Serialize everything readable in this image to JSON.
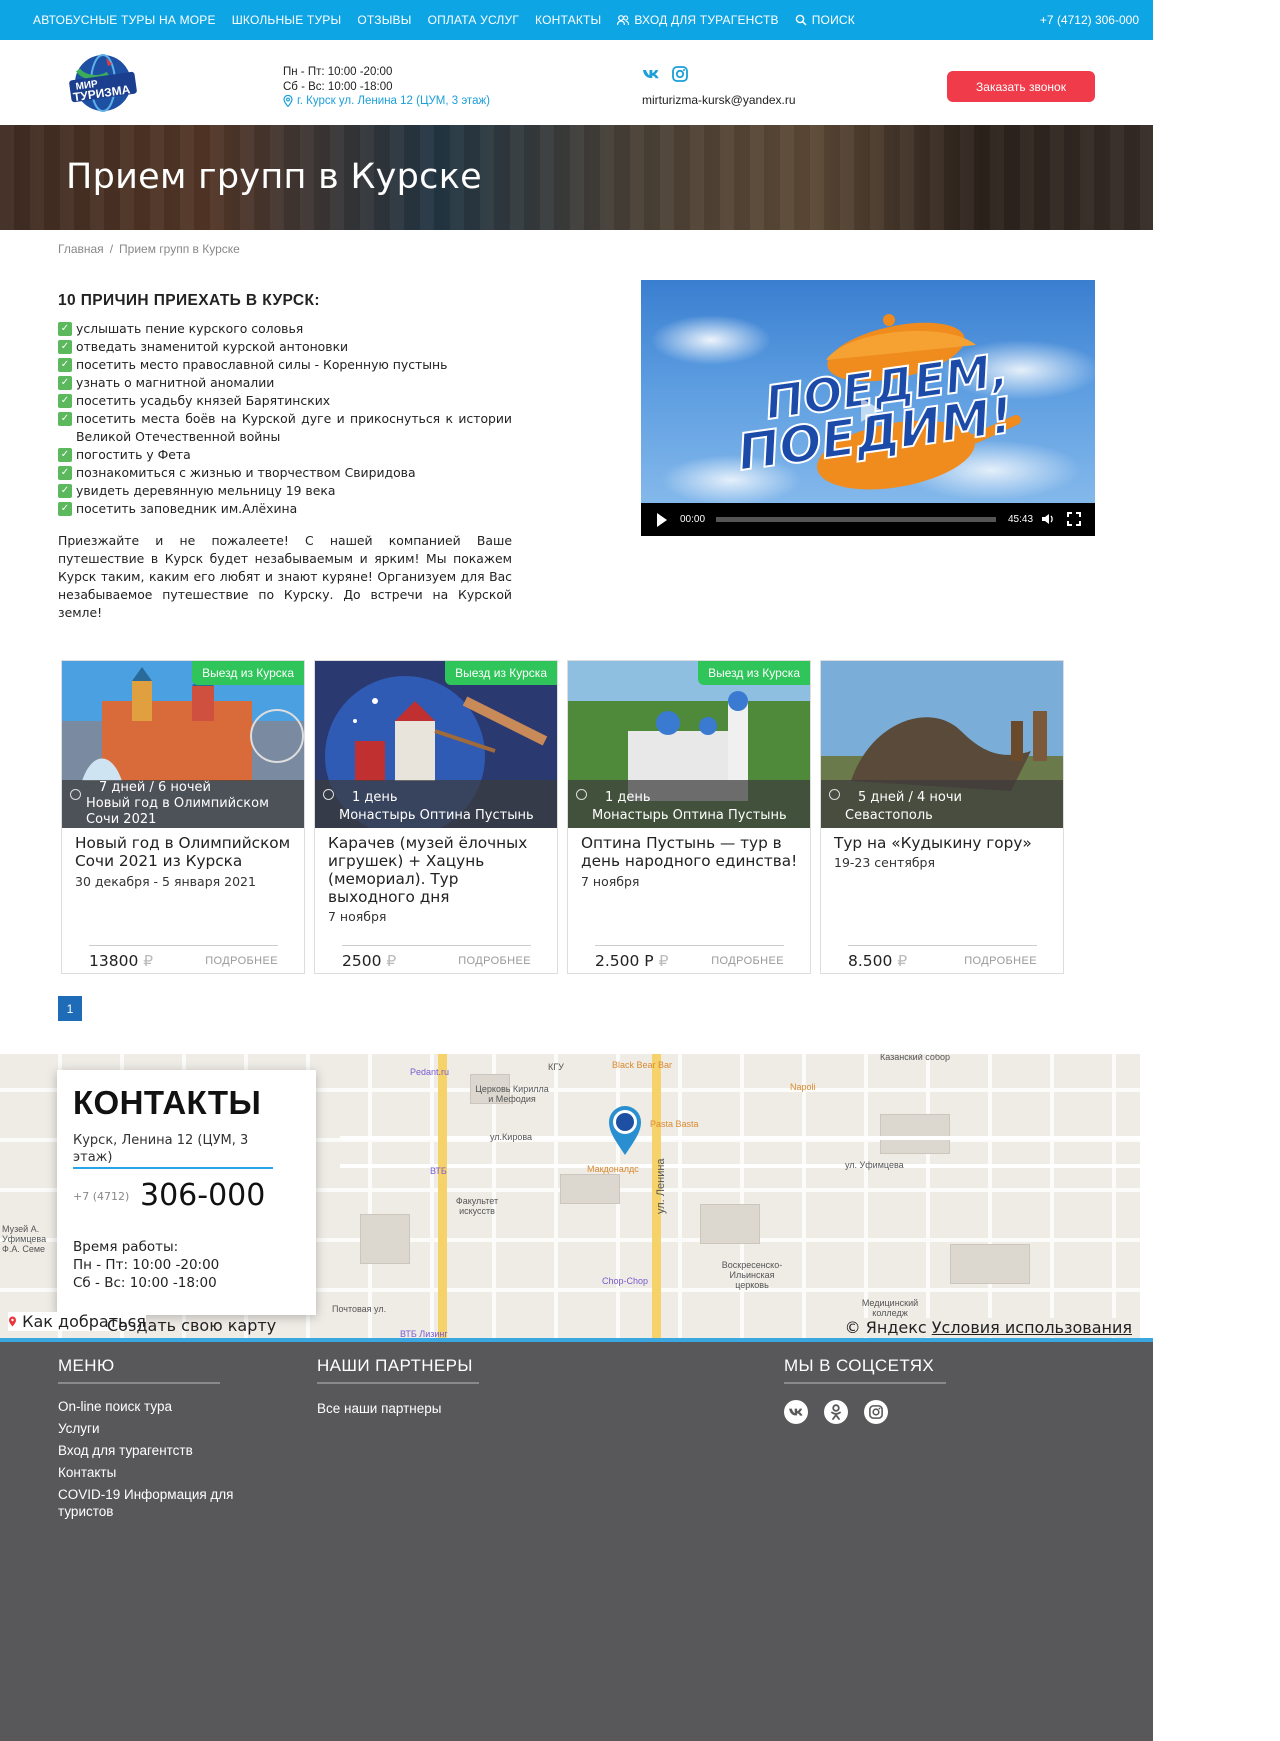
{
  "topbar": {
    "nav": [
      "АВТОБУСНЫЕ ТУРЫ НА МОРЕ",
      "ШКОЛЬНЫЕ ТУРЫ",
      "ОТЗЫВЫ",
      "ОПЛАТА УСЛУГ",
      "КОНТАКТЫ",
      "ВХОД ДЛЯ ТУРАГЕНСТВ",
      "ПОИСК"
    ],
    "phone": "+7 (4712) 306-000"
  },
  "header": {
    "logo_text": "МИР ТУРИЗМА",
    "hours_weekday": "Пн - Пт: 10:00 -20:00",
    "hours_weekend": "Сб - Вс: 10:00 -18:00",
    "address": "г. Курск ул. Ленина 12 (ЦУМ, 3 этаж)",
    "email": "mirturizma-kursk@yandex.ru",
    "call_button": "Заказать звонок",
    "social": [
      "vk-icon",
      "instagram-icon"
    ]
  },
  "banner": {
    "title": "Прием групп в Курске"
  },
  "breadcrumb": {
    "home": "Главная",
    "separator": "/",
    "current": "Прием групп в Курске"
  },
  "reasons": {
    "heading": "10 ПРИЧИН ПРИЕХАТЬ В КУРСК:",
    "items": [
      "услышать пение курского соловья",
      "отведать знаменитой курской антоновки",
      "посетить место православной силы - Коренную пустынь",
      "узнать о магнитной аномалии",
      "посетить усадьбу князей Барятинских",
      " посетить места боёв на Курской дуге и прикоснуться к истории Великой Отечественной войны",
      "погостить у Фета",
      "познакомиться с жизнью и творчеством Свиридова",
      "увидеть деревянную мельницу 19 века",
      "посетить заповедник им.Алёхина"
    ],
    "paragraph": "Приезжайте и не пожалеете! С нашей компанией Ваше путешествие в Курск будет незабываемым и ярким! Мы покажем Курск таким, каким его любят и знают куряне! Организуем для Вас незабываемое путешествие по Курску. До встречи на Курской земле!"
  },
  "video": {
    "poster_text_line1": "ПОЕДЕМ,",
    "poster_text_line2": "ПОЕДИМ!",
    "current_time": "00:00",
    "duration": "45:43",
    "progress": 0
  },
  "cards": [
    {
      "tag": "Выезд из Курска",
      "duration": "7 дней / 6 ночей",
      "subtitle": "Новый год в Олимпийском Сочи 2021",
      "title": "Новый год в Олимпийском Сочи 2021 из Курска",
      "date": "30 декабря - 5 января 2021",
      "price": "13800",
      "currency": "₽",
      "more": "ПОДРОБНЕЕ"
    },
    {
      "tag": "Выезд из Курска",
      "duration": "1 день",
      "subtitle": "Монастырь Оптина Пустынь",
      "title": "Карачев (музей ёлочных игрушек) + Хацунь (мемориал). Тур выходного дня",
      "date": "7 ноября",
      "price": "2500",
      "currency": "₽",
      "more": "ПОДРОБНЕЕ"
    },
    {
      "tag": "Выезд из Курска",
      "duration": "1 день",
      "subtitle": "Монастырь Оптина Пустынь",
      "title": "Оптина Пустынь — тур в день народного единства!",
      "date": "7 ноября",
      "price": "2.500 Р",
      "currency": "₽",
      "more": "ПОДРОБНЕЕ"
    },
    {
      "tag": "",
      "duration": "5 дней / 4 ночи",
      "subtitle": "Севастополь",
      "title": "Тур на «Кудыкину гору»",
      "date": "19-23 сентября",
      "price": "8.500",
      "currency": "₽",
      "more": "ПОДРОБНЕЕ"
    }
  ],
  "pagination": {
    "current": "1"
  },
  "map": {
    "labels": [
      "ул.Кирова",
      "ул. Уфимцева",
      "ул. Ленина",
      "Почтовая ул.",
      "Макдоналдс",
      "Pasta Basta",
      "Black Bear Bar",
      "Napoli",
      "ВТБ",
      "Pedant.ru",
      "КГУ",
      "Церковь Кирилла и Мефодия",
      "Факультет искусств",
      "Chop-Chop",
      "Воскресенско-Ильинская церковь",
      "Медицинский колледж",
      "Музей А. Уфимцева Ф.А. Семе",
      "ВТБ Лизинг",
      "Казанский собор"
    ],
    "route_button": "Как добраться",
    "create_map": "Создать свою карту",
    "copyright": "© Яндекс",
    "terms": "Условия использования"
  },
  "contacts": {
    "heading": "КОНТАКТЫ",
    "address": "Курск, Ленина 12 (ЦУМ, 3 этаж)",
    "phone_code": "+7 (4712)",
    "phone_number": "306-000",
    "work_label": "Время работы:",
    "work_weekday": "Пн - Пт: 10:00 -20:00",
    "work_weekend": "Сб - Вс: 10:00 -18:00"
  },
  "footer": {
    "menu_heading": "МЕНЮ",
    "menu": [
      "On-line поиск тура",
      "Услуги",
      "Вход для турагентств",
      "Контакты",
      "COVID-19 Информация для туристов"
    ],
    "partners_heading": "НАШИ ПАРТНЕРЫ",
    "partners": [
      "Все наши партнеры"
    ],
    "social_heading": "МЫ В СОЦСЕТЯХ",
    "social": [
      "vk-icon",
      "odnoklassniki-icon",
      "instagram-icon"
    ]
  },
  "colors": {
    "topbar": "#0ea5e4",
    "call_button": "#f03c4a",
    "tag": "#2fc55a",
    "footer": "#58585a",
    "pager": "#1e6bb8"
  }
}
